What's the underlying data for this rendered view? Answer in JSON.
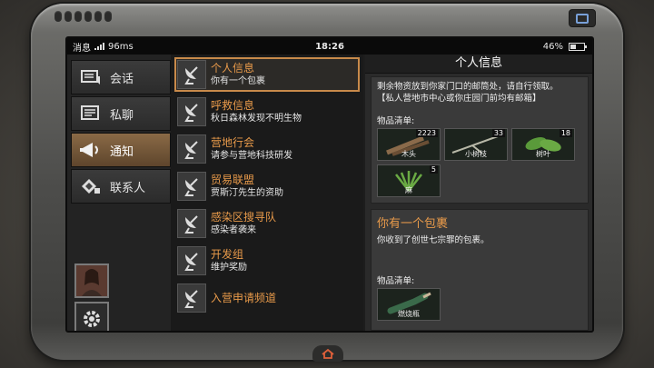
{
  "status": {
    "carrier": "消息",
    "ping": "96ms",
    "time": "18:26",
    "battery": "46%",
    "battery_level": 0.46
  },
  "nav": {
    "items": [
      {
        "label": "会话",
        "icon": "chat-icon"
      },
      {
        "label": "私聊",
        "icon": "private-chat-icon"
      },
      {
        "label": "通知",
        "icon": "megaphone-icon",
        "active": true
      },
      {
        "label": "联系人",
        "icon": "contacts-icon"
      }
    ]
  },
  "channels": [
    {
      "title": "个人信息",
      "sub": "你有一个包裹",
      "active": true
    },
    {
      "title": "呼救信息",
      "sub": "秋日森林发现不明生物"
    },
    {
      "title": "营地行会",
      "sub": "请参与营地科技研发"
    },
    {
      "title": "贸易联盟",
      "sub": "贾斯汀先生的资助"
    },
    {
      "title": "感染区搜寻队",
      "sub": "感染者袭来"
    },
    {
      "title": "开发组",
      "sub": "维护奖励"
    },
    {
      "title": "入营申请频道",
      "sub": ""
    }
  ],
  "detail": {
    "header": "个人信息",
    "card1": {
      "text1": "剩余物资放到你家门口的邮筒处，请自行领取。",
      "text2": "【私人营地市中心或你庄园门前均有邮箱】",
      "items_label": "物品清单:",
      "items": [
        {
          "name": "木头",
          "count": "2223"
        },
        {
          "name": "小树枝",
          "count": "33"
        },
        {
          "name": "树叶",
          "count": "18"
        },
        {
          "name": "麻",
          "count": "5"
        }
      ]
    },
    "card2": {
      "title": "你有一个包裹",
      "text": "你收到了创世七宗罪的包裹。",
      "items_label": "物品清单:",
      "items": [
        {
          "name": "燃烧瓶",
          "count": ""
        }
      ]
    }
  },
  "colors": {
    "accent": "#e89a4a",
    "active_nav": "#8a6a46"
  }
}
